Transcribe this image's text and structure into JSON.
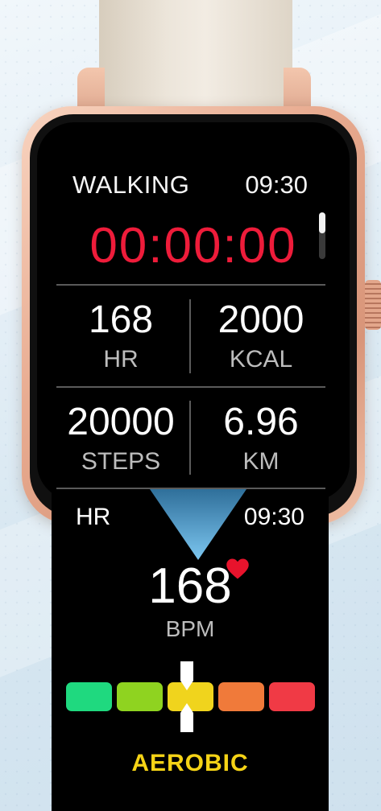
{
  "workout": {
    "mode": "WALKING",
    "time": "09:30",
    "timer": "00:00:00",
    "stats": [
      {
        "value": "168",
        "unit": "HR"
      },
      {
        "value": "2000",
        "unit": "KCAL"
      },
      {
        "value": "20000",
        "unit": "STEPS"
      },
      {
        "value": "6.96",
        "unit": "KM"
      }
    ]
  },
  "heart_rate": {
    "label": "HR",
    "time": "09:30",
    "bpm": "168",
    "unit": "BPM",
    "zone_label": "AEROBIC",
    "zones": [
      "#1fd97f",
      "#8fd320",
      "#f0d41d",
      "#f07a3a",
      "#f03a45"
    ],
    "active_zone_index": 2,
    "zone_label_color": "#f5d316"
  },
  "icons": {
    "heart": "heart-icon",
    "marker": "zone-marker-icon"
  },
  "colors": {
    "timer": "#ee1c3a",
    "heart": "#e8132c"
  }
}
